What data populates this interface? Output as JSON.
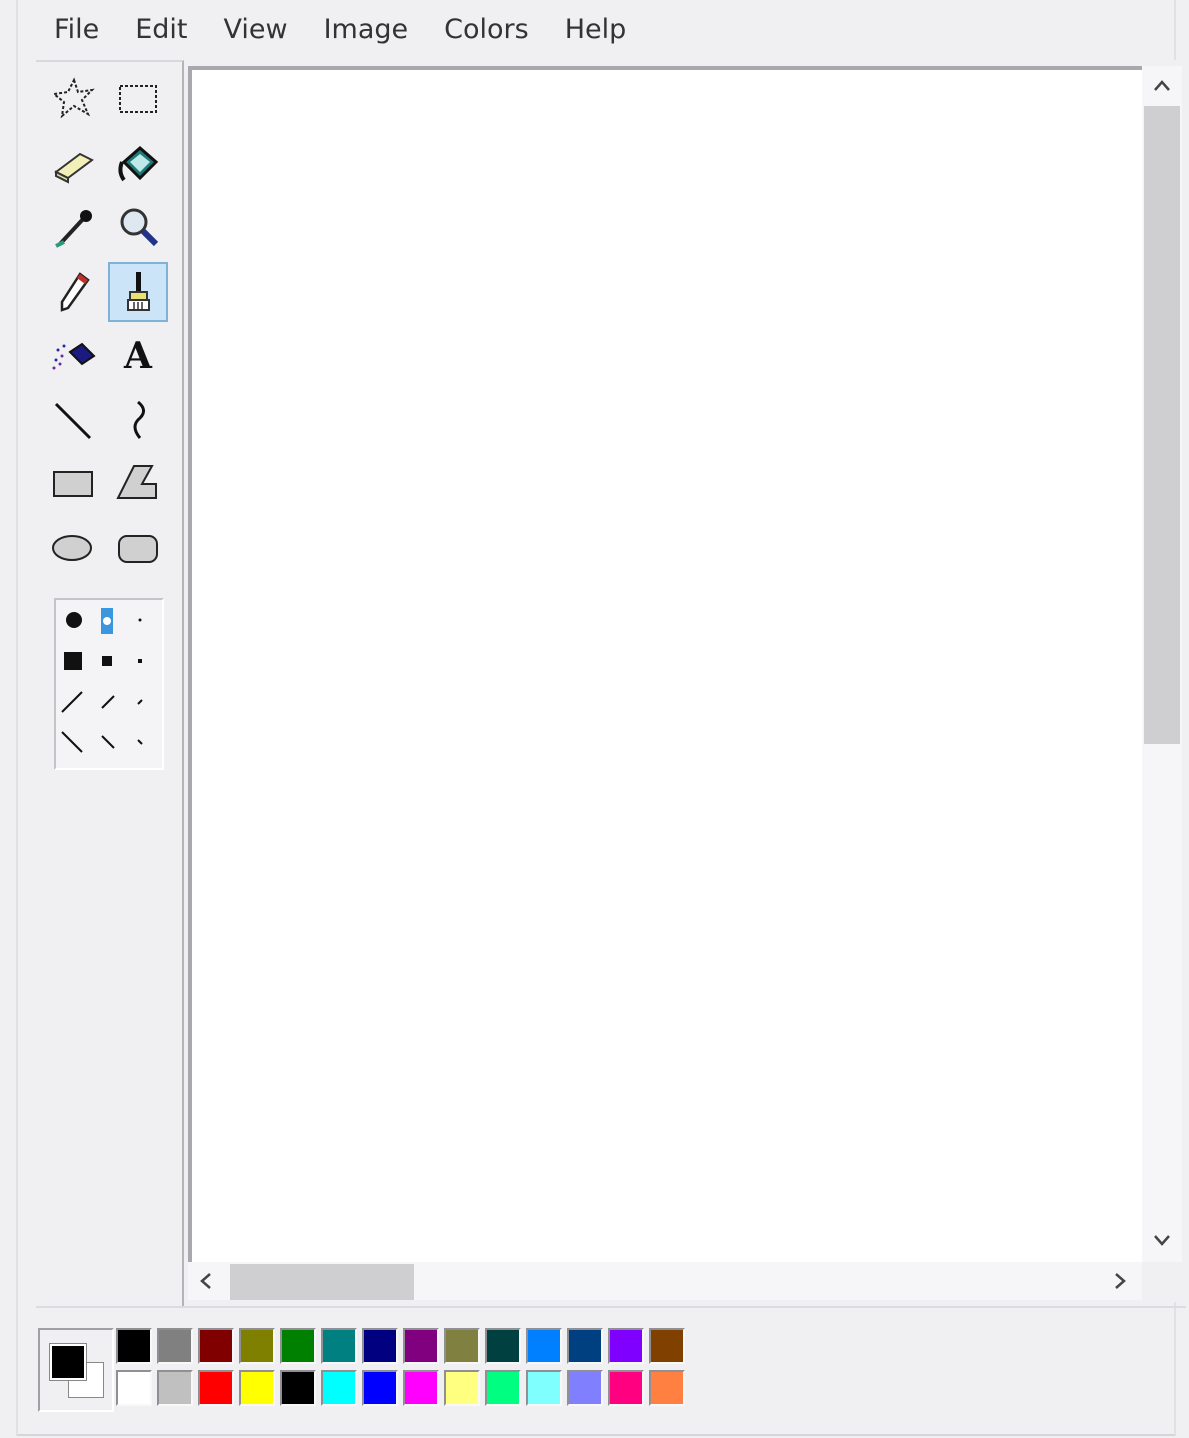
{
  "menu": [
    "File",
    "Edit",
    "View",
    "Image",
    "Colors",
    "Help"
  ],
  "tools": [
    {
      "name": "free-form-select-icon"
    },
    {
      "name": "select-icon"
    },
    {
      "name": "eraser-icon"
    },
    {
      "name": "fill-with-color-icon"
    },
    {
      "name": "pick-color-icon"
    },
    {
      "name": "magnifier-icon"
    },
    {
      "name": "pencil-icon"
    },
    {
      "name": "brush-icon",
      "selected": true
    },
    {
      "name": "airbrush-icon"
    },
    {
      "name": "text-icon",
      "glyph": "A"
    },
    {
      "name": "line-icon"
    },
    {
      "name": "curve-icon"
    },
    {
      "name": "rectangle-icon"
    },
    {
      "name": "polygon-icon"
    },
    {
      "name": "ellipse-icon"
    },
    {
      "name": "rounded-rectangle-icon"
    }
  ],
  "brush_options": {
    "selected": "round-medium"
  },
  "scroll": {
    "up": "^",
    "down": "v",
    "left": "<",
    "right": ">"
  },
  "colors": {
    "foreground": "#000000",
    "background": "#ffffff",
    "top_row": [
      "#000000",
      "#808080",
      "#800000",
      "#808000",
      "#008000",
      "#008080",
      "#000080",
      "#800080",
      "#808040",
      "#004040",
      "#0080ff",
      "#004080",
      "#8000ff",
      "#804000"
    ],
    "bottom_row": [
      "#ffffff",
      "#c0c0c0",
      "#ff0000",
      "#ffff00",
      "#000000",
      "#00ffff",
      "#0000ff",
      "#ff00ff",
      "#ffff80",
      "#00ff80",
      "#80ffff",
      "#8080ff",
      "#ff0080",
      "#ff8040"
    ]
  }
}
